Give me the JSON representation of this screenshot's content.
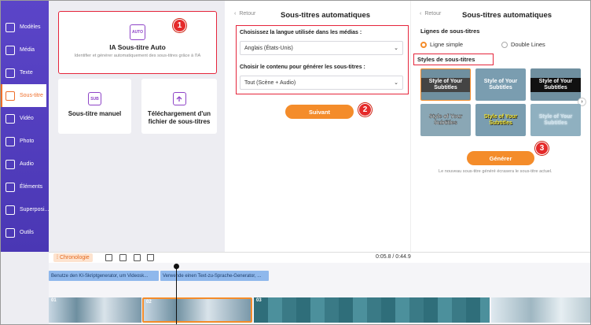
{
  "sidebar": {
    "items": [
      {
        "label": "Modèles",
        "icon": "templates-icon"
      },
      {
        "label": "Média",
        "icon": "media-icon"
      },
      {
        "label": "Texte",
        "icon": "text-icon"
      },
      {
        "label": "Sous-titre",
        "icon": "subtitle-icon",
        "active": true
      },
      {
        "label": "Vidéo",
        "icon": "video-icon"
      },
      {
        "label": "Photo",
        "icon": "photo-icon"
      },
      {
        "label": "Audio",
        "icon": "audio-icon"
      },
      {
        "label": "Éléments",
        "icon": "elements-icon"
      },
      {
        "label": "Superposi...",
        "icon": "overlay-icon"
      },
      {
        "label": "Outils",
        "icon": "tools-icon"
      }
    ]
  },
  "left_panel": {
    "auto_icon_text": "AUTO",
    "auto_title": "IA Sous-titre Auto",
    "auto_desc": "Identifier et générer automatiquement des sous-titres grâce à l'IA",
    "manual_icon_text": "SUB",
    "manual_label": "Sous-titre manuel",
    "upload_label": "Téléchargement d'un fichier de sous-titres"
  },
  "badges": {
    "one": "1",
    "two": "2",
    "three": "3"
  },
  "mid_panel": {
    "back_label": "Retour",
    "title": "Sous-titres automatiques",
    "lang_label": "Choisissez la langue utilisée dans les médias :",
    "lang_value": "Anglais (États-Unis)",
    "content_label": "Choisir le contenu pour générer les sous-titres :",
    "content_value": "Tout (Scène + Audio)",
    "next_button": "Suivant"
  },
  "right_panel": {
    "back_label": "Retour",
    "title": "Sous-titres automatiques",
    "lines_title": "Lignes de sous-titres",
    "line_simple": "Ligne simple",
    "line_double": "Double Lines",
    "styles_title": "Styles de sous-titres",
    "style_text": "Style of Your Subtitles",
    "generate_button": "Générer",
    "note": "Le nouveau sous-titre généré écrasera le sous-titre actuel."
  },
  "timeline": {
    "chrono_label": "Chronologie",
    "time": "0:05.8 / 0:44.9",
    "subtitle_clips": [
      "Benutze den KI-Skriptgenerator, um Videosk...",
      "Verwende einen Text-zu-Sprache-Generator, ..."
    ],
    "clip_numbers": [
      "01",
      "02",
      "03"
    ]
  },
  "colors": {
    "accent": "#f48c2a",
    "sidebar": "#5b45c8",
    "highlight": "#e5253b"
  }
}
